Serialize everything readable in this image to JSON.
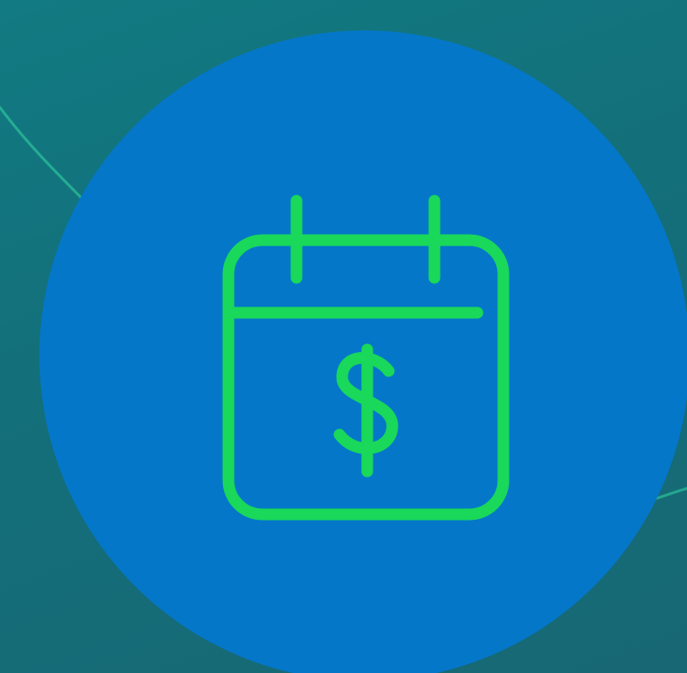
{
  "colors": {
    "background_start": "#127a82",
    "background_end": "#176874",
    "badge_fill": "#0477c9",
    "icon_stroke": "#19d85a",
    "accent_line": "#2bc09a"
  },
  "icon": {
    "name": "calendar-dollar-icon",
    "symbol": "$"
  }
}
